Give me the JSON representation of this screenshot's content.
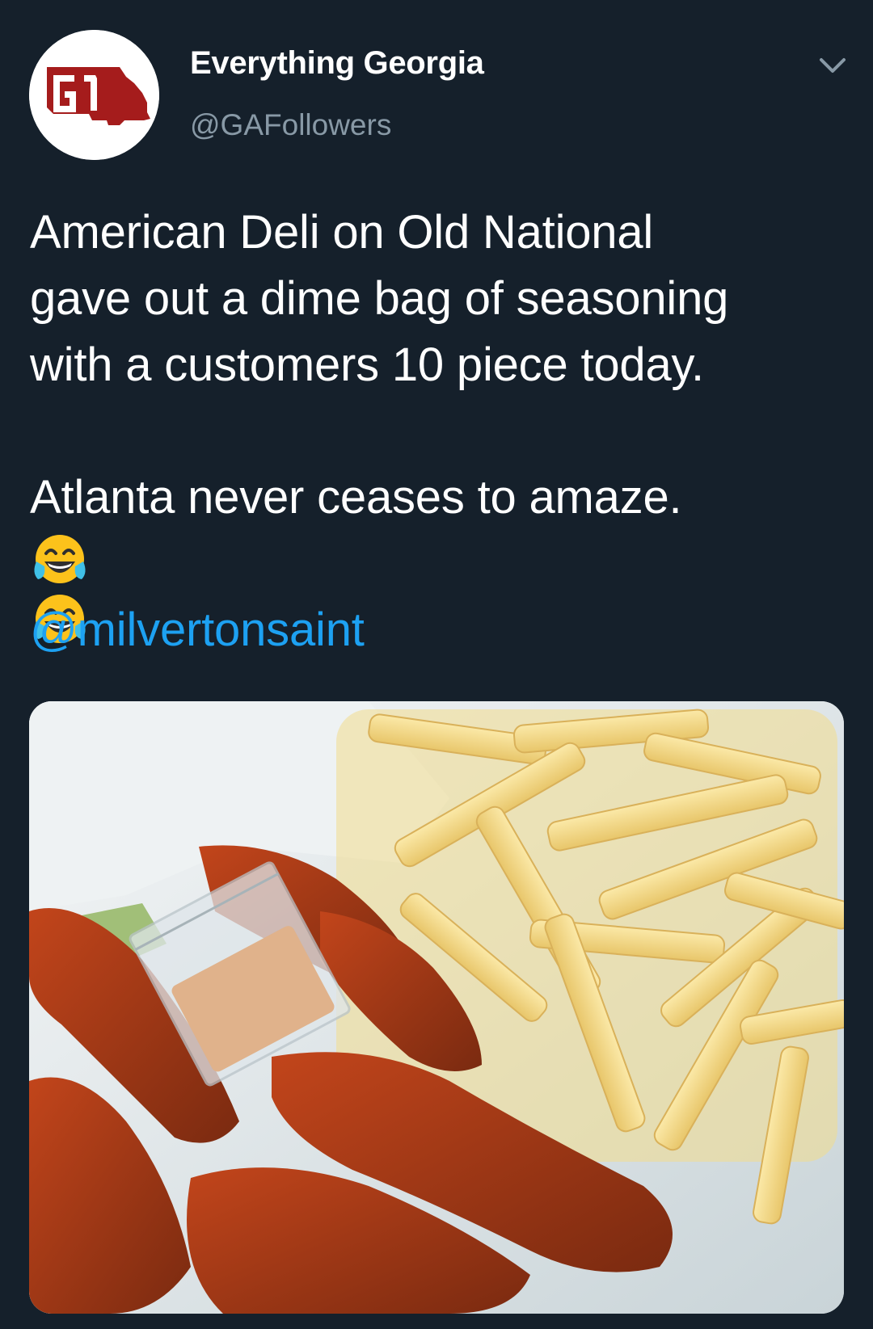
{
  "account": {
    "display_name": "Everything Georgia",
    "handle": "@GAFollowers",
    "avatar_icon": "georgia-state-logo-icon",
    "avatar_colors": {
      "background": "#ffffff",
      "logo": "#a51c1c"
    }
  },
  "menu": {
    "icon": "chevron-down-icon"
  },
  "tweet": {
    "lines": [
      "American Deli on Old National",
      "gave out a dime bag of seasoning",
      "with a customers 10 piece today.",
      "",
      "Atlanta never ceases to amaze."
    ],
    "emojis": [
      "face-with-tears-of-joy-icon",
      "face-with-tears-of-joy-icon"
    ],
    "mention": "@milvertonsaint"
  },
  "media": {
    "subject": "chicken wings, crinkle fries and small bag of seasoning"
  },
  "colors": {
    "background": "#15202b",
    "text_primary": "#ffffff",
    "text_secondary": "#8899a6",
    "link": "#1da1f2"
  }
}
